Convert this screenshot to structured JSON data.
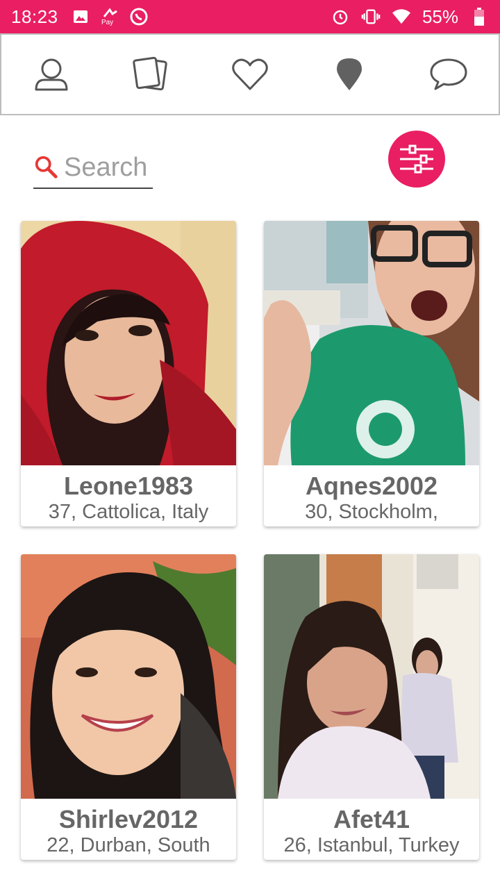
{
  "status_bar": {
    "time": "18:23",
    "battery": "55%",
    "pay_label": "Pay",
    "bg_color": "#e91e63"
  },
  "nav": {
    "items": [
      "profile-icon",
      "cards-icon",
      "heart-icon",
      "location-pin-icon",
      "chat-bubble-icon"
    ]
  },
  "search": {
    "placeholder": "Search"
  },
  "filter": {
    "icon": "sliders-icon",
    "color": "#e91e63"
  },
  "profiles": [
    {
      "name": "Leone1983",
      "meta": "37, Cattolica, Italy"
    },
    {
      "name": "Aqnes2002",
      "meta": "30, Stockholm,"
    },
    {
      "name": "Shirlev2012",
      "meta": "22, Durban, South"
    },
    {
      "name": "Afet41",
      "meta": "26, Istanbul, Turkey"
    }
  ]
}
